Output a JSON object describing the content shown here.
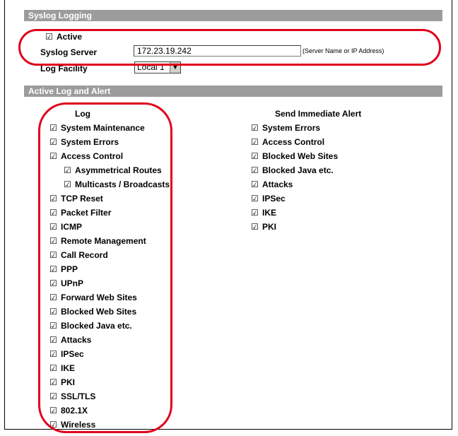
{
  "syslog": {
    "section_title": "Syslog Logging",
    "active_label": "Active",
    "active_checked": true,
    "server_label": "Syslog Server",
    "server_value": "172.23.19.242",
    "server_hint": "(Server Name or IP Address)",
    "facility_label": "Log Facility",
    "facility_value": "Local 1"
  },
  "alerts": {
    "section_title": "Active Log and Alert",
    "log_header": "Log",
    "alert_header": "Send Immediate Alert",
    "log_items": [
      {
        "label": "System Maintenance",
        "checked": true
      },
      {
        "label": "System Errors",
        "checked": true
      },
      {
        "label": "Access Control",
        "checked": true
      },
      {
        "label": "Asymmetrical Routes",
        "checked": true
      },
      {
        "label": "Multicasts / Broadcasts",
        "checked": true
      },
      {
        "label": "TCP Reset",
        "checked": true
      },
      {
        "label": "Packet Filter",
        "checked": true
      },
      {
        "label": "ICMP",
        "checked": true
      },
      {
        "label": "Remote Management",
        "checked": true
      },
      {
        "label": "Call Record",
        "checked": true
      },
      {
        "label": "PPP",
        "checked": true
      },
      {
        "label": "UPnP",
        "checked": true
      },
      {
        "label": "Forward Web Sites",
        "checked": true
      },
      {
        "label": "Blocked Web Sites",
        "checked": true
      },
      {
        "label": "Blocked Java etc.",
        "checked": true
      },
      {
        "label": "Attacks",
        "checked": true
      },
      {
        "label": "IPSec",
        "checked": true
      },
      {
        "label": "IKE",
        "checked": true
      },
      {
        "label": "PKI",
        "checked": true
      },
      {
        "label": "SSL/TLS",
        "checked": true
      },
      {
        "label": "802.1X",
        "checked": true
      },
      {
        "label": "Wireless",
        "checked": true
      }
    ],
    "alert_items": [
      {
        "label": "System Errors",
        "checked": true
      },
      {
        "label": "Access Control",
        "checked": true
      },
      {
        "label": "Blocked Web Sites",
        "checked": true
      },
      {
        "label": "Blocked Java etc.",
        "checked": true
      },
      {
        "label": "Attacks",
        "checked": true
      },
      {
        "label": "IPSec",
        "checked": true
      },
      {
        "label": "IKE",
        "checked": true
      },
      {
        "label": "PKI",
        "checked": true
      }
    ]
  },
  "checkbox_glyph": "☑",
  "highlight_color": "#e0001b",
  "section_bar_color": "#9c9c9c"
}
